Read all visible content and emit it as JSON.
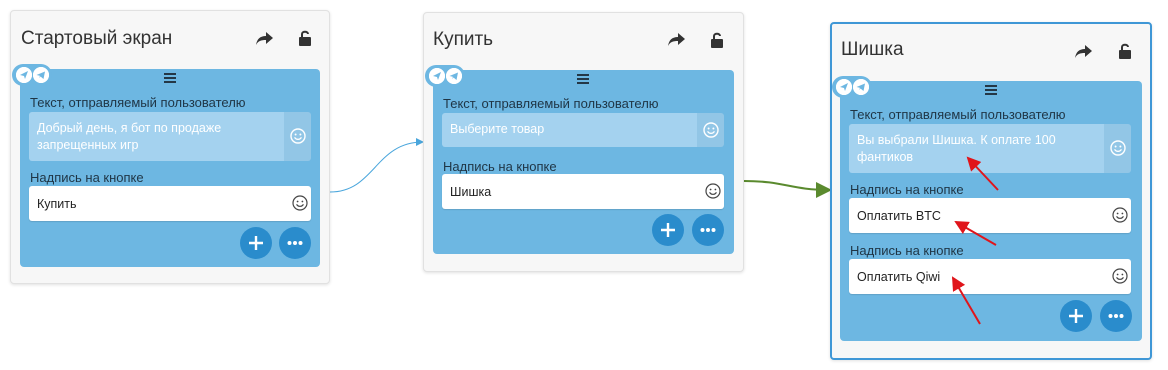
{
  "common": {
    "message_label": "Текст, отправляемый пользователю",
    "button_label": "Надпись на кнопке"
  },
  "cards": [
    {
      "title": "Стартовый экран",
      "message": "Добрый день, я бот по продаже запрещенных игр",
      "buttons": [
        "Купить"
      ]
    },
    {
      "title": "Купить",
      "message": "Выберите товар",
      "buttons": [
        "Шишка"
      ]
    },
    {
      "title": "Шишка",
      "message": "Вы выбрали Шишка. К оплате 100 фантиков",
      "buttons": [
        "Оплатить BTC",
        "Оплатить Qiwi"
      ]
    }
  ],
  "colors": {
    "panel": "#6db7e2",
    "action_button": "#2a8ccc",
    "selected_border": "#3f97d6",
    "connector_blue": "#4aa6dc",
    "connector_green": "#5a8a2e",
    "annotation_arrow": "#e0151b"
  },
  "icons": [
    "share-icon",
    "unlock-icon",
    "navigation-icon",
    "telegram-icon",
    "drag-handle-icon",
    "emoji-icon",
    "plus-icon",
    "more-icon"
  ]
}
